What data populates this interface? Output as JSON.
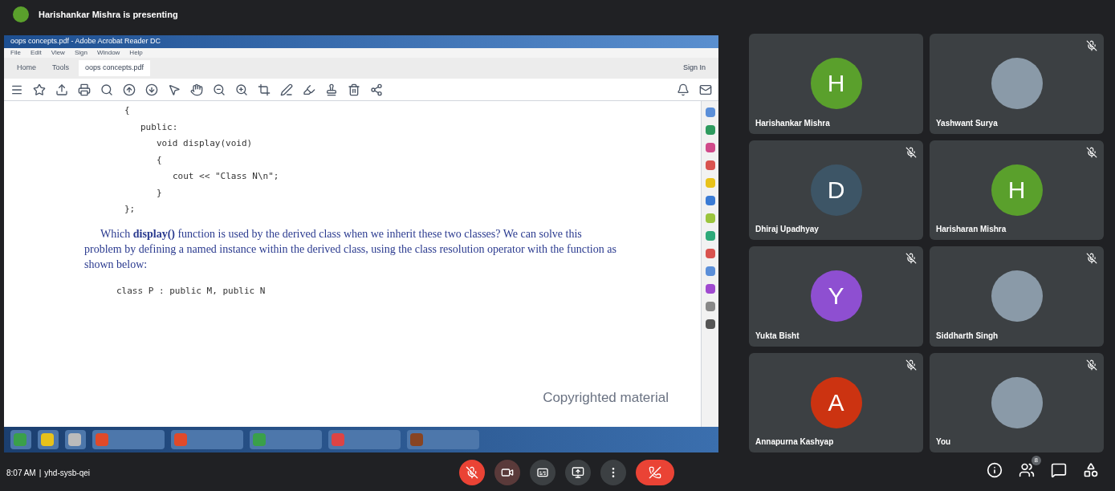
{
  "presenting_banner": {
    "text": "Harishankar Mishra is presenting"
  },
  "shared_window": {
    "title": "oops concepts.pdf - Adobe Acrobat Reader DC",
    "menu": [
      "File",
      "Edit",
      "View",
      "Sign",
      "Window",
      "Help"
    ],
    "tabs": [
      {
        "label": "Home",
        "selected": false
      },
      {
        "label": "Tools",
        "selected": false
      },
      {
        "label": "oops concepts.pdf",
        "selected": true
      }
    ],
    "sign_in": "Sign In",
    "code_lines_top": [
      {
        "text": "{",
        "children": [
          {
            "text": "public:",
            "children": [
              {
                "text": "void display(void)"
              },
              {
                "text": "{",
                "children": [
                  {
                    "text": "cout << \"Class N\\n\";"
                  }
                ]
              },
              {
                "text": "}"
              }
            ]
          }
        ]
      },
      {
        "text": "};"
      }
    ],
    "paragraph": "Which **display()** function is used by the derived class when we inherit these two classes? We can solve this problem by defining a named instance within the derived class, using the class resolution operator with the function as shown below:",
    "code_line_bottom": "class P : public M, public N",
    "page_mark": "Copyrighted material"
  },
  "participants": [
    {
      "name": "Harishankar Mishra",
      "kind": "letter",
      "letter": "H",
      "color": "#5aa02c",
      "muted": false
    },
    {
      "name": "Yashwant Surya",
      "kind": "photo",
      "muted": true
    },
    {
      "name": "Dhiraj Upadhyay",
      "kind": "letter",
      "letter": "D",
      "color": "#3d5566",
      "muted": true
    },
    {
      "name": "Harisharan Mishra",
      "kind": "letter",
      "letter": "H",
      "color": "#5aa02c",
      "muted": true
    },
    {
      "name": "Yukta Bisht",
      "kind": "letter",
      "letter": "Y",
      "color": "#8e4fd1",
      "muted": true
    },
    {
      "name": "Siddharth Singh",
      "kind": "photo",
      "muted": true
    },
    {
      "name": "Annapurna Kashyap",
      "kind": "letter",
      "letter": "A",
      "color": "#cc3311",
      "muted": true
    },
    {
      "name": "You",
      "kind": "photo",
      "muted": true
    }
  ],
  "bottom_bar": {
    "time": "8:07 AM",
    "separator": "|",
    "meeting_code": "yhd-sysb-qei",
    "mic_on": false,
    "people_badge": "8"
  }
}
